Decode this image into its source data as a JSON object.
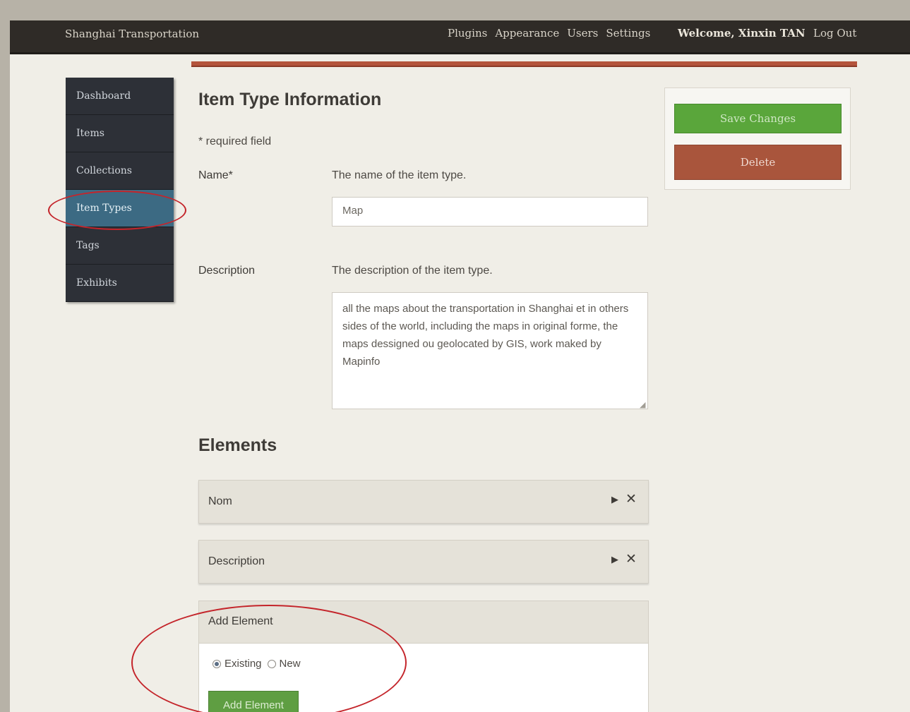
{
  "header": {
    "site_title": "Shanghai Transportation",
    "nav": [
      "Plugins",
      "Appearance",
      "Users",
      "Settings"
    ],
    "welcome": "Welcome, Xinxin TAN",
    "logout": "Log Out"
  },
  "sidebar": {
    "items": [
      {
        "label": "Dashboard"
      },
      {
        "label": "Items"
      },
      {
        "label": "Collections"
      },
      {
        "label": "Item Types"
      },
      {
        "label": "Tags"
      },
      {
        "label": "Exhibits"
      }
    ]
  },
  "form": {
    "heading": "Item Type Information",
    "required_note": "* required field",
    "name_label": "Name*",
    "name_hint": "The name of the item type.",
    "name_value": "Map",
    "description_label": "Description",
    "description_hint": "The description of the item type.",
    "description_value": "all the maps about the transportation in Shanghai et in others sides of the world, including the maps in original forme, the maps dessigned ou geolocated by GIS, work maked by Mapinfo"
  },
  "elements": {
    "heading": "Elements",
    "rows": [
      {
        "name": "Nom"
      },
      {
        "name": "Description"
      }
    ],
    "add_panel": {
      "title": "Add Element",
      "option_existing": "Existing",
      "option_new": "New",
      "button": "Add Element"
    }
  },
  "actions": {
    "save": "Save Changes",
    "delete": "Delete"
  }
}
